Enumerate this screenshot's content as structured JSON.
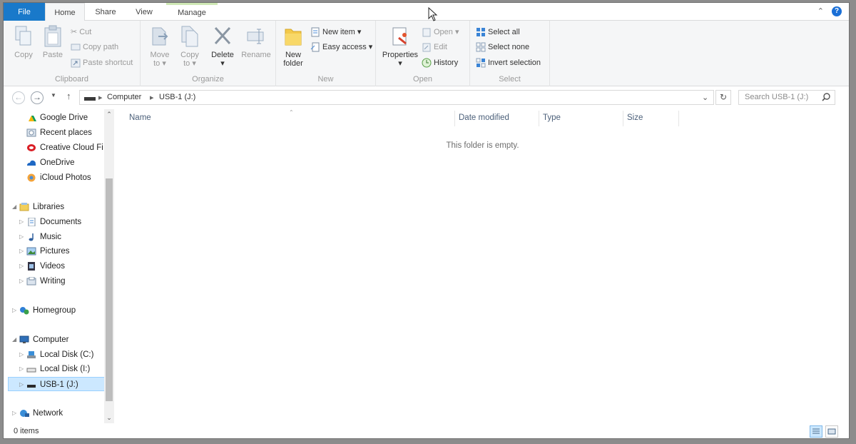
{
  "tabs": {
    "file": "File",
    "home": "Home",
    "share": "Share",
    "view": "View",
    "manage": "Manage"
  },
  "ribbon": {
    "clipboard": {
      "label": "Clipboard",
      "copy": "Copy",
      "paste": "Paste",
      "cut": "Cut",
      "copy_path": "Copy path",
      "paste_shortcut": "Paste shortcut"
    },
    "organize": {
      "label": "Organize",
      "move_to": "Move",
      "move_to2": "to",
      "copy_to": "Copy",
      "copy_to2": "to",
      "delete": "Delete",
      "rename": "Rename"
    },
    "new": {
      "label": "New",
      "new_folder": "New",
      "new_folder2": "folder",
      "new_item": "New item",
      "easy_access": "Easy access"
    },
    "open": {
      "label": "Open",
      "properties": "Properties",
      "open": "Open",
      "edit": "Edit",
      "history": "History"
    },
    "select": {
      "label": "Select",
      "select_all": "Select all",
      "select_none": "Select none",
      "invert": "Invert selection"
    }
  },
  "address": {
    "root": "Computer",
    "current": "USB-1 (J:)"
  },
  "search": {
    "placeholder": "Search USB-1 (J:)"
  },
  "nav": {
    "google_drive": "Google Drive",
    "recent_places": "Recent places",
    "creative_cloud": "Creative Cloud Fi",
    "onedrive": "OneDrive",
    "icloud": "iCloud Photos",
    "libraries": "Libraries",
    "documents": "Documents",
    "music": "Music",
    "pictures": "Pictures",
    "videos": "Videos",
    "writing": "Writing",
    "homegroup": "Homegroup",
    "computer": "Computer",
    "local_c": "Local Disk (C:)",
    "local_i": "Local Disk (I:)",
    "usb": "USB-1 (J:)",
    "network": "Network"
  },
  "columns": {
    "name": "Name",
    "date_modified": "Date modified",
    "type": "Type",
    "size": "Size"
  },
  "empty_message": "This folder is empty.",
  "status": {
    "count": "0 items"
  },
  "colors": {
    "accent": "#1979ca",
    "selection": "#cce8ff"
  }
}
